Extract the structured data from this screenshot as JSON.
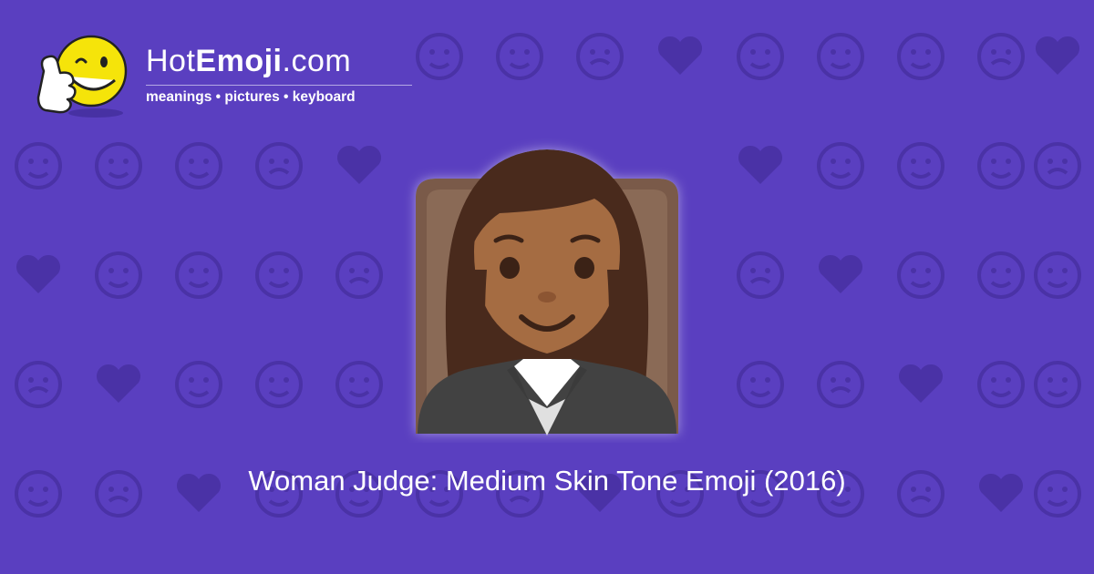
{
  "brand": {
    "name_plain_prefix": "Hot",
    "name_bold": "Emoji",
    "name_plain_suffix": ".com",
    "tagline": "meanings • pictures • keyboard",
    "logo_icon": "thumbs-up-wink-smiley-icon"
  },
  "hero": {
    "emoji_icon": "woman-judge-medium-skin-tone-icon",
    "caption": "Woman Judge: Medium Skin Tone Emoji (2016)"
  },
  "colors": {
    "background": "#5a3fc0",
    "pattern": "#4a32a6",
    "text": "#ffffff",
    "skin": "#a56c43",
    "hair": "#4a2c1f",
    "robe": "#424242",
    "chair": "#7a5a48"
  }
}
